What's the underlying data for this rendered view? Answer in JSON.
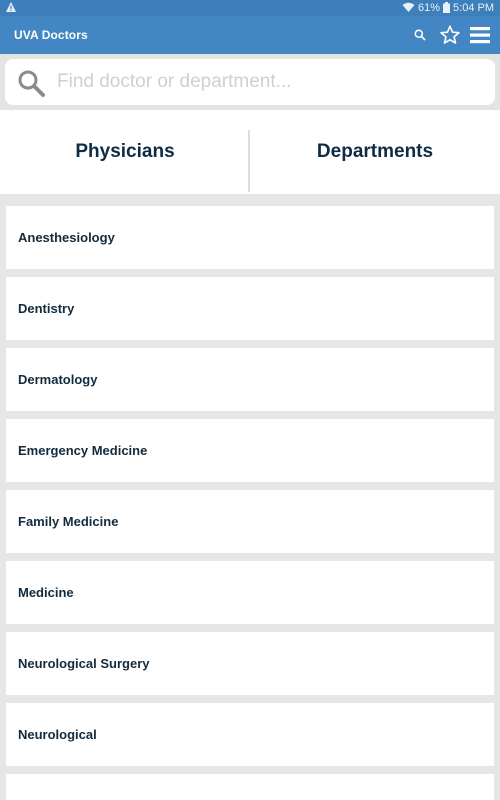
{
  "status_bar": {
    "left_icon": "warning-triangle-icon",
    "wifi_icon": "wifi-icon",
    "battery_percent": "61%",
    "battery_icon": "battery-icon",
    "time": "5:04 PM"
  },
  "app_bar": {
    "title": "UVA Doctors",
    "search_icon": "search-icon",
    "favorites_icon": "star-outline-icon",
    "menu_icon": "hamburger-menu-icon"
  },
  "search": {
    "placeholder": "Find doctor or department...",
    "value": ""
  },
  "tabs": [
    {
      "label": "Physicians",
      "selected": false
    },
    {
      "label": "Departments",
      "selected": true
    }
  ],
  "colors": {
    "app_bar": "#4287c3",
    "tab_indicator": "#a6cbe9",
    "text_dark": "#0f2b44"
  },
  "departments": [
    {
      "name": "Anesthesiology"
    },
    {
      "name": "Dentistry"
    },
    {
      "name": "Dermatology"
    },
    {
      "name": "Emergency Medicine"
    },
    {
      "name": "Family Medicine"
    },
    {
      "name": "Medicine"
    },
    {
      "name": "Neurological Surgery"
    },
    {
      "name": "Neurological"
    }
  ]
}
